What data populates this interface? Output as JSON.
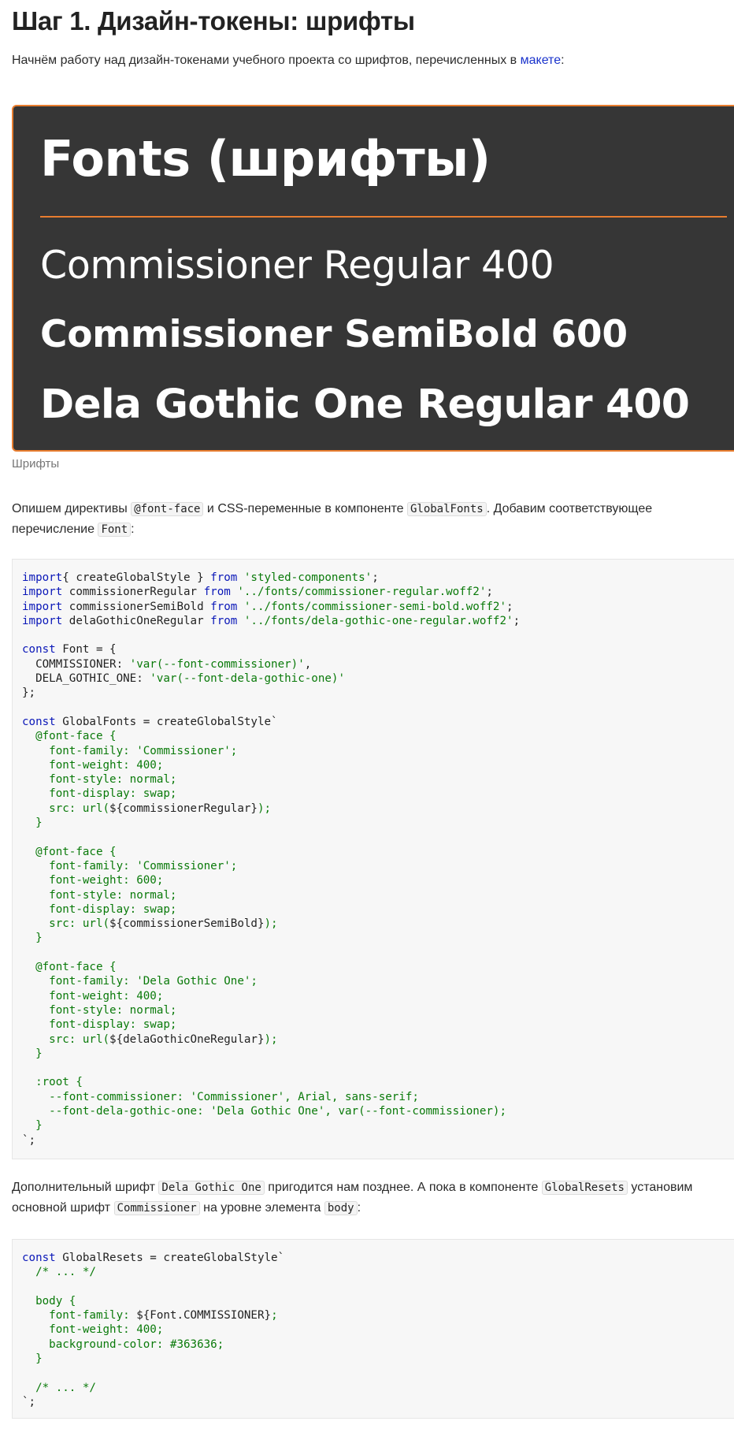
{
  "heading": "Шаг 1. Дизайн-токены: шрифты",
  "intro": {
    "text": "Начнём работу над дизайн-токенами учебного проекта со шрифтов, перечисленных в ",
    "link": "макете",
    "after": ":"
  },
  "figure": {
    "title": "Fonts (шрифты)",
    "lines": [
      "Commissioner Regular 400",
      "Commissioner SemiBold 600",
      "Dela Gothic One Regular 400"
    ],
    "colors": {
      "background": "#363636",
      "accent": "#e87d2f",
      "text": "#ffffff"
    },
    "caption": "Шрифты"
  },
  "para2": {
    "t1": "Опишем директивы ",
    "c1": "@font-face",
    "t2": " и CSS-переменные в компоненте ",
    "c2": "GlobalFonts",
    "t3": ". Добавим соответствующее перечисление ",
    "c3": "Font",
    "t4": ":"
  },
  "code1": [
    [
      [
        "kw",
        "import"
      ],
      [
        "",
        "{ createGlobalStyle } "
      ],
      [
        "kw",
        "from"
      ],
      [
        "",
        " "
      ],
      [
        "str",
        "'styled-components'"
      ],
      [
        "",
        ";"
      ]
    ],
    [
      [
        "kw",
        "import"
      ],
      [
        "",
        " commissionerRegular "
      ],
      [
        "kw",
        "from"
      ],
      [
        "",
        " "
      ],
      [
        "str",
        "'../fonts/commissioner-regular.woff2'"
      ],
      [
        "",
        ";"
      ]
    ],
    [
      [
        "kw",
        "import"
      ],
      [
        "",
        " commissionerSemiBold "
      ],
      [
        "kw",
        "from"
      ],
      [
        "",
        " "
      ],
      [
        "str",
        "'../fonts/commissioner-semi-bold.woff2'"
      ],
      [
        "",
        ";"
      ]
    ],
    [
      [
        "kw",
        "import"
      ],
      [
        "",
        " delaGothicOneRegular "
      ],
      [
        "kw",
        "from"
      ],
      [
        "",
        " "
      ],
      [
        "str",
        "'../fonts/dela-gothic-one-regular.woff2'"
      ],
      [
        "",
        ";"
      ]
    ],
    [
      [
        "",
        ""
      ]
    ],
    [
      [
        "kw",
        "const"
      ],
      [
        "",
        " Font = {"
      ]
    ],
    [
      [
        "",
        "  COMMISSIONER: "
      ],
      [
        "str",
        "'var(--font-commissioner)'"
      ],
      [
        "",
        ","
      ]
    ],
    [
      [
        "",
        "  DELA_GOTHIC_ONE: "
      ],
      [
        "str",
        "'var(--font-dela-gothic-one)'"
      ]
    ],
    [
      [
        "",
        "};"
      ]
    ],
    [
      [
        "",
        ""
      ]
    ],
    [
      [
        "kw",
        "const"
      ],
      [
        "",
        " GlobalFonts = createGlobalStyle`"
      ]
    ],
    [
      [
        "str",
        "  @font-face {"
      ]
    ],
    [
      [
        "str",
        "    font-family: 'Commissioner';"
      ]
    ],
    [
      [
        "str",
        "    font-weight: 400;"
      ]
    ],
    [
      [
        "str",
        "    font-style: normal;"
      ]
    ],
    [
      [
        "str",
        "    font-display: swap;"
      ]
    ],
    [
      [
        "str",
        "    src: url("
      ],
      [
        "",
        "${commissionerRegular}"
      ],
      [
        "str",
        ");"
      ]
    ],
    [
      [
        "str",
        "  }"
      ]
    ],
    [
      [
        "",
        ""
      ]
    ],
    [
      [
        "str",
        "  @font-face {"
      ]
    ],
    [
      [
        "str",
        "    font-family: 'Commissioner';"
      ]
    ],
    [
      [
        "str",
        "    font-weight: 600;"
      ]
    ],
    [
      [
        "str",
        "    font-style: normal;"
      ]
    ],
    [
      [
        "str",
        "    font-display: swap;"
      ]
    ],
    [
      [
        "str",
        "    src: url("
      ],
      [
        "",
        "${commissionerSemiBold}"
      ],
      [
        "str",
        ");"
      ]
    ],
    [
      [
        "str",
        "  }"
      ]
    ],
    [
      [
        "",
        ""
      ]
    ],
    [
      [
        "str",
        "  @font-face {"
      ]
    ],
    [
      [
        "str",
        "    font-family: 'Dela Gothic One';"
      ]
    ],
    [
      [
        "str",
        "    font-weight: 400;"
      ]
    ],
    [
      [
        "str",
        "    font-style: normal;"
      ]
    ],
    [
      [
        "str",
        "    font-display: swap;"
      ]
    ],
    [
      [
        "str",
        "    src: url("
      ],
      [
        "",
        "${delaGothicOneRegular}"
      ],
      [
        "str",
        ");"
      ]
    ],
    [
      [
        "str",
        "  }"
      ]
    ],
    [
      [
        "",
        ""
      ]
    ],
    [
      [
        "str",
        "  :root {"
      ]
    ],
    [
      [
        "str",
        "    --font-commissioner: 'Commissioner', Arial, sans-serif;"
      ]
    ],
    [
      [
        "str",
        "    --font-dela-gothic-one: 'Dela Gothic One', var(--font-commissioner);"
      ]
    ],
    [
      [
        "str",
        "  }"
      ]
    ],
    [
      [
        "",
        "`;"
      ]
    ]
  ],
  "para3": {
    "t1": "Дополнительный шрифт ",
    "c1": "Dela Gothic One",
    "t2": " пригодится нам позднее. А пока в компоненте ",
    "c2": "GlobalResets",
    "t3": " установим основной шрифт ",
    "c3": "Commissioner",
    "t4": " на уровне элемента ",
    "c4": "body",
    "t5": ":"
  },
  "code2": [
    [
      [
        "kw",
        "const"
      ],
      [
        "",
        " GlobalResets = createGlobalStyle`"
      ]
    ],
    [
      [
        "str",
        "  /* ... */"
      ]
    ],
    [
      [
        "",
        ""
      ]
    ],
    [
      [
        "str",
        "  body {"
      ]
    ],
    [
      [
        "str",
        "    font-family: "
      ],
      [
        "",
        "${Font.COMMISSIONER}"
      ],
      [
        "str",
        ";"
      ]
    ],
    [
      [
        "str",
        "    font-weight: 400;"
      ]
    ],
    [
      [
        "str",
        "    background-color: #363636;"
      ]
    ],
    [
      [
        "str",
        "  }"
      ]
    ],
    [
      [
        "",
        ""
      ]
    ],
    [
      [
        "str",
        "  /* ... */"
      ]
    ],
    [
      [
        "",
        "`;"
      ]
    ]
  ]
}
